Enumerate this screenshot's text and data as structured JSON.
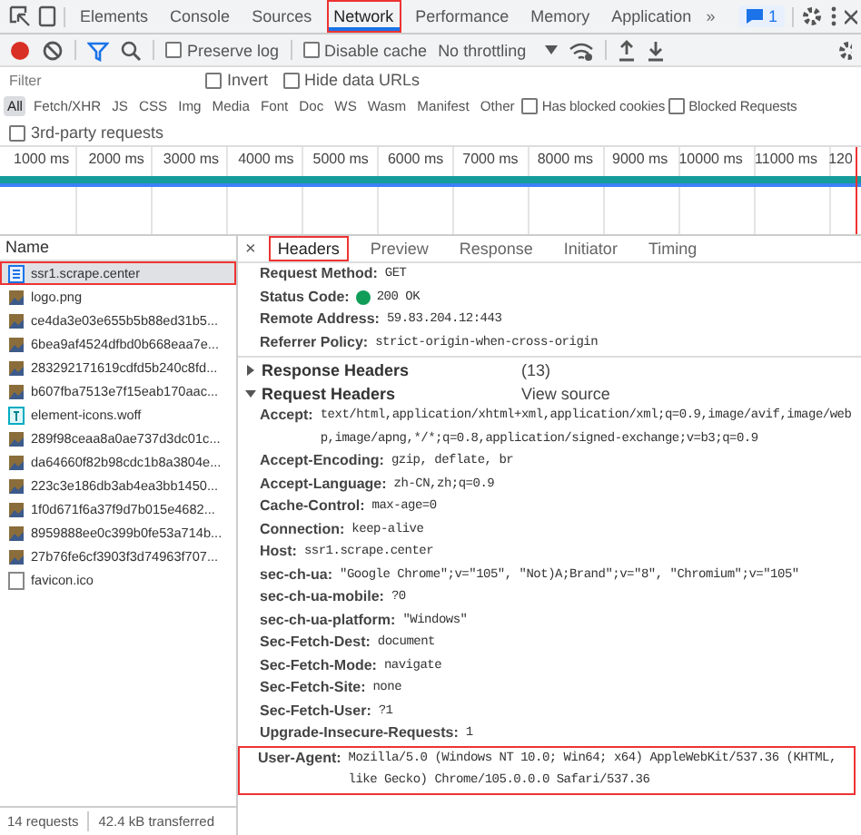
{
  "panel_tabs": [
    {
      "label": "Elements",
      "selected": false,
      "highlighted": false
    },
    {
      "label": "Console",
      "selected": false,
      "highlighted": false
    },
    {
      "label": "Sources",
      "selected": false,
      "highlighted": false
    },
    {
      "label": "Network",
      "selected": true,
      "highlighted": true
    },
    {
      "label": "Performance",
      "selected": false,
      "highlighted": false
    },
    {
      "label": "Memory",
      "selected": false,
      "highlighted": false
    },
    {
      "label": "Application",
      "selected": false,
      "highlighted": false
    }
  ],
  "more_tabs": "»",
  "issues_badge": "1",
  "toolbar": {
    "recording": true,
    "preserve_log": {
      "label": "Preserve log",
      "checked": false
    },
    "disable_cache": {
      "label": "Disable cache",
      "checked": false
    },
    "throttling": "No throttling"
  },
  "filter": {
    "placeholder": "Filter",
    "invert": {
      "label": "Invert",
      "checked": false
    },
    "hide_data_urls": {
      "label": "Hide data URLs",
      "checked": false
    }
  },
  "type_filters": [
    {
      "label": "All",
      "selected": true
    },
    {
      "label": "Fetch/XHR",
      "selected": false
    },
    {
      "label": "JS",
      "selected": false
    },
    {
      "label": "CSS",
      "selected": false
    },
    {
      "label": "Img",
      "selected": false
    },
    {
      "label": "Media",
      "selected": false
    },
    {
      "label": "Font",
      "selected": false
    },
    {
      "label": "Doc",
      "selected": false
    },
    {
      "label": "WS",
      "selected": false
    },
    {
      "label": "Wasm",
      "selected": false
    },
    {
      "label": "Manifest",
      "selected": false
    },
    {
      "label": "Other",
      "selected": false
    }
  ],
  "extra_filters": [
    {
      "label": "Has blocked cookies",
      "checked": false
    },
    {
      "label": "Blocked Requests",
      "checked": false
    },
    {
      "label": "3rd-party requests",
      "checked": false
    }
  ],
  "timeline": {
    "ticks": [
      "1000 ms",
      "2000 ms",
      "3000 ms",
      "4000 ms",
      "5000 ms",
      "6000 ms",
      "7000 ms",
      "8000 ms",
      "9000 ms",
      "10000 ms",
      "11000 ms",
      "120"
    ]
  },
  "requests": {
    "column": "Name",
    "items": [
      {
        "name": "ssr1.scrape.center",
        "kind": "doc",
        "selected": true,
        "highlighted": true
      },
      {
        "name": "logo.png",
        "kind": "image",
        "selected": false,
        "highlighted": false
      },
      {
        "name": "ce4da3e03e655b5b88ed31b5...",
        "kind": "image",
        "selected": false,
        "highlighted": false
      },
      {
        "name": "6bea9af4524dfbd0b668eaa7e...",
        "kind": "image",
        "selected": false,
        "highlighted": false
      },
      {
        "name": "283292171619cdfd5b240c8fd...",
        "kind": "image",
        "selected": false,
        "highlighted": false
      },
      {
        "name": "b607fba7513e7f15eab170aac...",
        "kind": "image",
        "selected": false,
        "highlighted": false
      },
      {
        "name": "element-icons.woff",
        "kind": "font",
        "selected": false,
        "highlighted": false
      },
      {
        "name": "289f98ceaa8a0ae737d3dc01c...",
        "kind": "image",
        "selected": false,
        "highlighted": false
      },
      {
        "name": "da64660f82b98cdc1b8a3804e...",
        "kind": "image",
        "selected": false,
        "highlighted": false
      },
      {
        "name": "223c3e186db3ab4ea3bb1450...",
        "kind": "image",
        "selected": false,
        "highlighted": false
      },
      {
        "name": "1f0d671f6a37f9d7b015e4682...",
        "kind": "image",
        "selected": false,
        "highlighted": false
      },
      {
        "name": "8959888ee0c399b0fe53a714b...",
        "kind": "image",
        "selected": false,
        "highlighted": false
      },
      {
        "name": "27b76fe6cf3903f3d74963f707...",
        "kind": "image",
        "selected": false,
        "highlighted": false
      },
      {
        "name": "favicon.ico",
        "kind": "other",
        "selected": false,
        "highlighted": false
      }
    ]
  },
  "detail_tabs": [
    {
      "label": "Headers",
      "selected": true,
      "highlighted": true
    },
    {
      "label": "Preview",
      "selected": false,
      "highlighted": false
    },
    {
      "label": "Response",
      "selected": false,
      "highlighted": false
    },
    {
      "label": "Initiator",
      "selected": false,
      "highlighted": false
    },
    {
      "label": "Timing",
      "selected": false,
      "highlighted": false
    }
  ],
  "close_detail": "×",
  "general": [
    {
      "key": "Request Method:",
      "value": "GET"
    },
    {
      "key": "Status Code:",
      "value": "200 OK",
      "color": "#0f9d58"
    },
    {
      "key": "Remote Address:",
      "value": "59.83.204.12:443"
    },
    {
      "key": "Referrer Policy:",
      "value": "strict-origin-when-cross-origin"
    }
  ],
  "sections": [
    {
      "title": "Response Headers",
      "aside": "(13)",
      "expanded": false
    },
    {
      "title": "Request Headers",
      "aside": "View source",
      "expanded": true
    }
  ],
  "request_headers": [
    {
      "key": "Accept:",
      "value": "text/html,application/xhtml+xml,application/xml;q=0.9,image/avif,image/webp,image/apng,*/*;q=0.8,application/signed-exchange;v=b3;q=0.9",
      "highlighted": false
    },
    {
      "key": "Accept-Encoding:",
      "value": "gzip, deflate, br",
      "highlighted": false
    },
    {
      "key": "Accept-Language:",
      "value": "zh-CN,zh;q=0.9",
      "highlighted": false
    },
    {
      "key": "Cache-Control:",
      "value": "max-age=0",
      "highlighted": false
    },
    {
      "key": "Connection:",
      "value": "keep-alive",
      "highlighted": false
    },
    {
      "key": "Host:",
      "value": "ssr1.scrape.center",
      "highlighted": false
    },
    {
      "key": "sec-ch-ua:",
      "value": "\"Google Chrome\";v=\"105\", \"Not)A;Brand\";v=\"8\", \"Chromium\";v=\"105\"",
      "highlighted": false
    },
    {
      "key": "sec-ch-ua-mobile:",
      "value": "?0",
      "highlighted": false
    },
    {
      "key": "sec-ch-ua-platform:",
      "value": "\"Windows\"",
      "highlighted": false
    },
    {
      "key": "Sec-Fetch-Dest:",
      "value": "document",
      "highlighted": false
    },
    {
      "key": "Sec-Fetch-Mode:",
      "value": "navigate",
      "highlighted": false
    },
    {
      "key": "Sec-Fetch-Site:",
      "value": "none",
      "highlighted": false
    },
    {
      "key": "Sec-Fetch-User:",
      "value": "?1",
      "highlighted": false
    },
    {
      "key": "Upgrade-Insecure-Requests:",
      "value": "1",
      "highlighted": false
    },
    {
      "key": "User-Agent:",
      "value": "Mozilla/5.0 (Windows NT 10.0; Win64; x64) AppleWebKit/537.36 (KHTML, like Gecko) Chrome/105.0.0.0 Safari/537.36",
      "highlighted": true
    }
  ],
  "status_bar": [
    "14 requests",
    "42.4 kB transferred"
  ]
}
